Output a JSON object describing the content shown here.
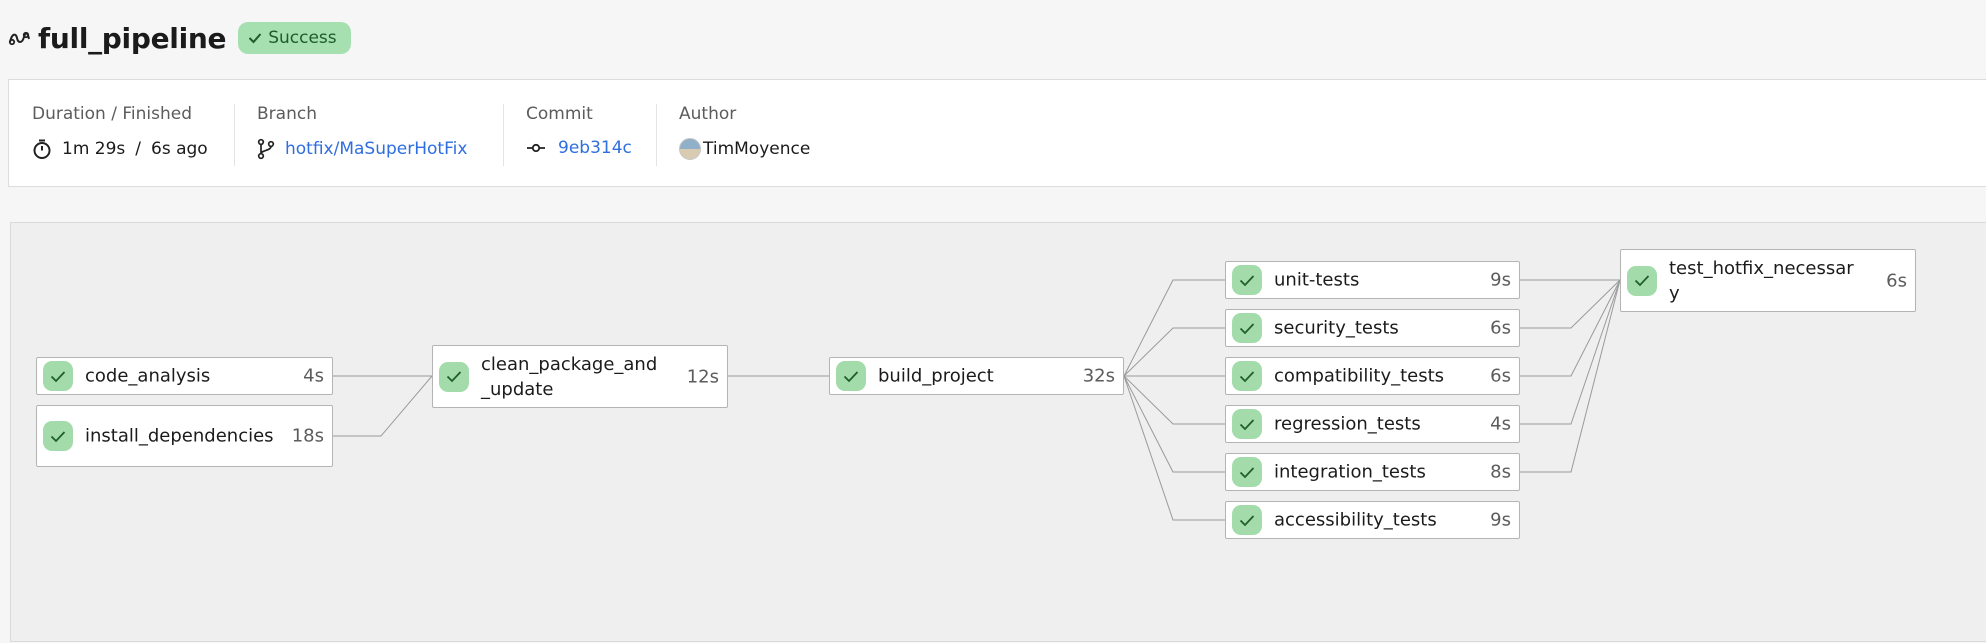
{
  "header": {
    "pipeline_icon": "pipeline-icon",
    "title": "full_pipeline",
    "status": {
      "label": "Success",
      "icon": "check-icon",
      "color": "#a6e0b0"
    }
  },
  "info": {
    "duration": {
      "label": "Duration / Finished",
      "icon": "timer-icon",
      "duration": "1m 29s",
      "separator": "/",
      "finished": "6s ago"
    },
    "branch": {
      "label": "Branch",
      "icon": "git-branch-icon",
      "value": "hotfix/MaSuperHotFix"
    },
    "commit": {
      "label": "Commit",
      "icon": "git-commit-icon",
      "value": "9eb314c"
    },
    "author": {
      "label": "Author",
      "avatar": "author-avatar",
      "value": "TimMoyence"
    }
  },
  "graph": {
    "status_color": "#a3dcaa",
    "nodes": {
      "code_analysis": {
        "name": "code_analysis",
        "duration": "4s",
        "status": "success"
      },
      "install_dependencies": {
        "name": "install_dependencies",
        "duration": "18s",
        "status": "success"
      },
      "clean_package_and_update": {
        "name": "clean_package_and_update",
        "duration": "12s",
        "status": "success"
      },
      "build_project": {
        "name": "build_project",
        "duration": "32s",
        "status": "success"
      },
      "unit_tests": {
        "name": "unit-tests",
        "duration": "9s",
        "status": "success"
      },
      "security_tests": {
        "name": "security_tests",
        "duration": "6s",
        "status": "success"
      },
      "compatibility_tests": {
        "name": "compatibility_tests",
        "duration": "6s",
        "status": "success"
      },
      "regression_tests": {
        "name": "regression_tests",
        "duration": "4s",
        "status": "success"
      },
      "integration_tests": {
        "name": "integration_tests",
        "duration": "8s",
        "status": "success"
      },
      "accessibility_tests": {
        "name": "accessibility_tests",
        "duration": "9s",
        "status": "success"
      },
      "test_hotfix_necessary": {
        "name": "test_hotfix_necessary",
        "duration": "6s",
        "status": "success"
      }
    }
  }
}
